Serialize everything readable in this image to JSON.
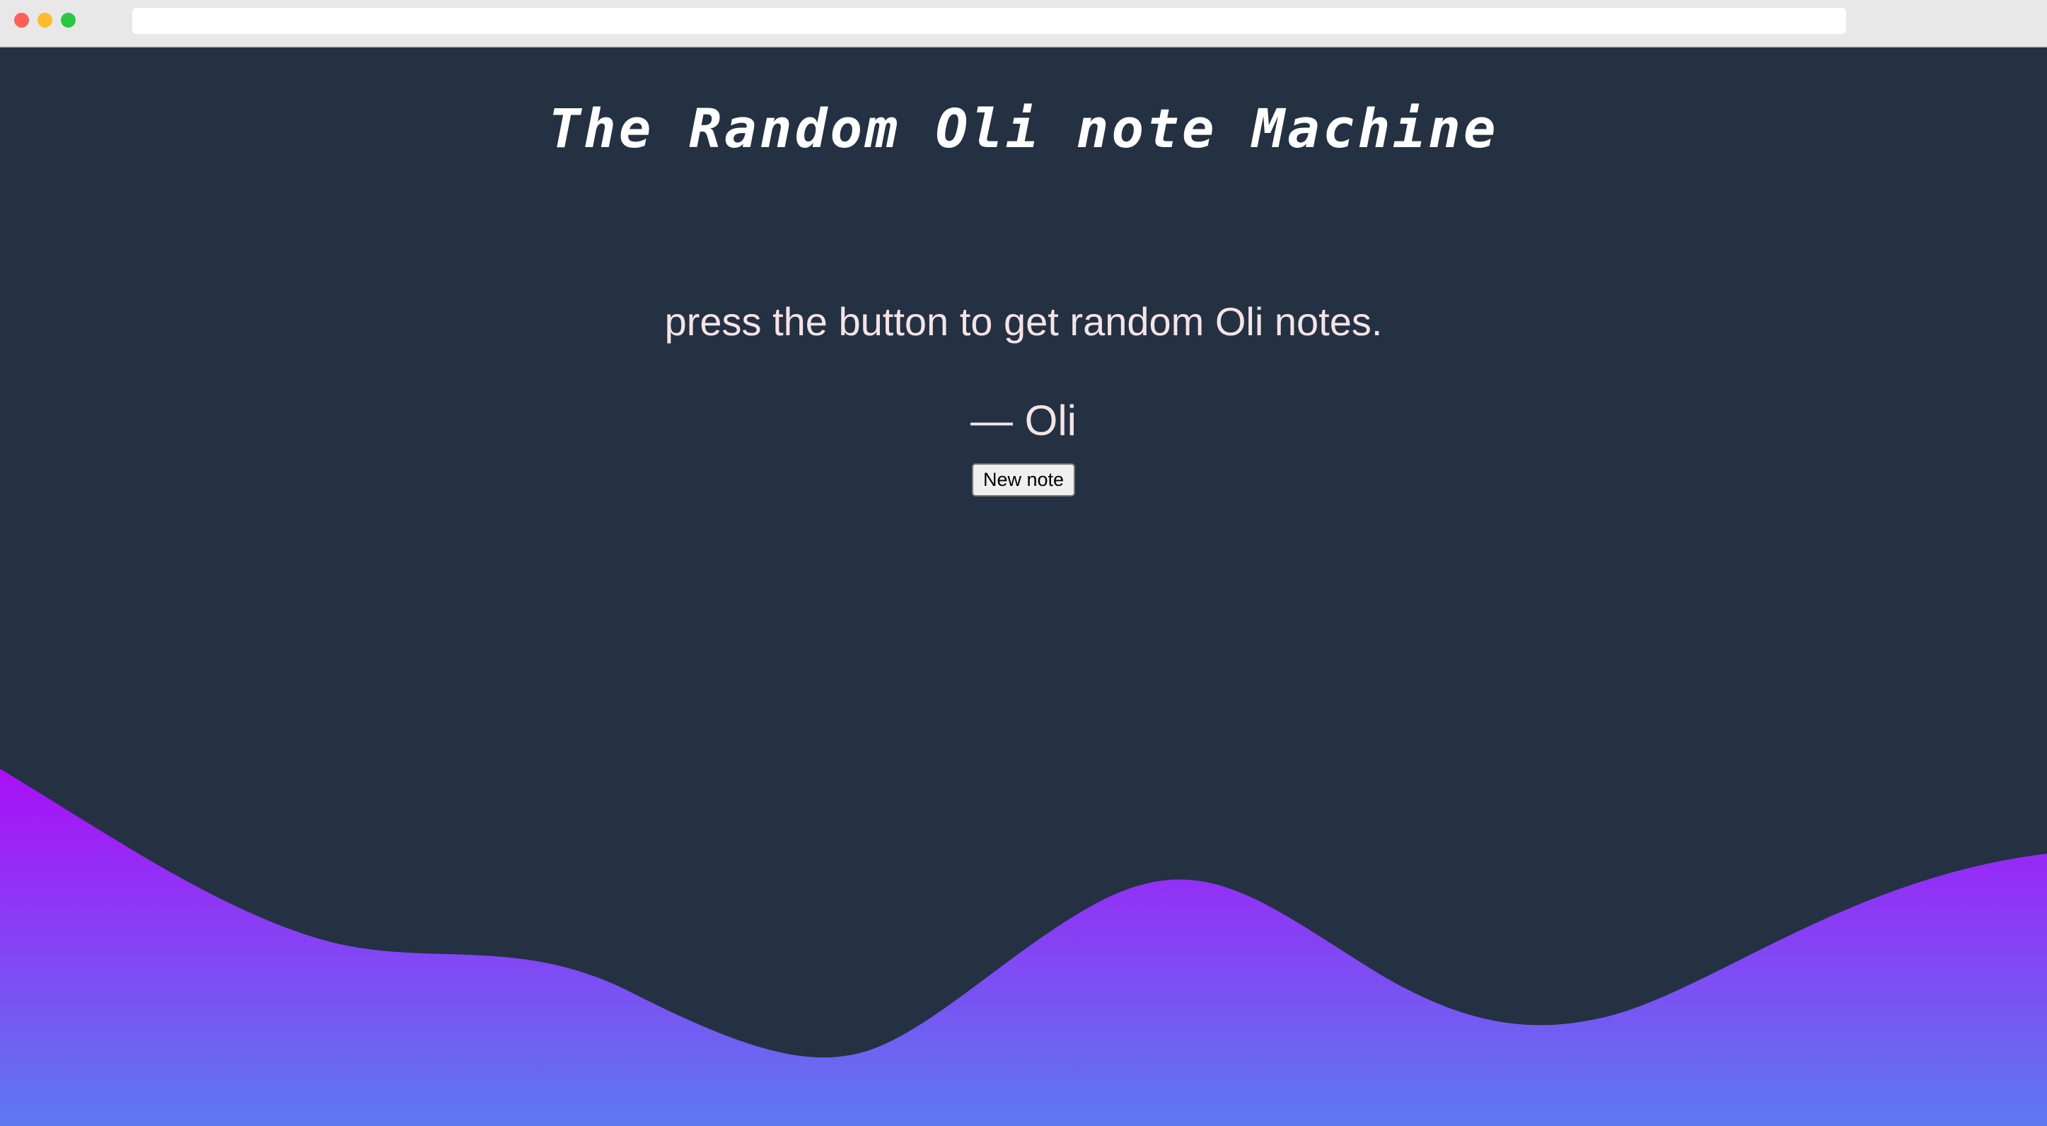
{
  "browser": {
    "address": ""
  },
  "app": {
    "title": "The Random Oli note Machine",
    "quote": "press the button to get random Oli notes.",
    "author": "— Oli",
    "button_label": "New note"
  },
  "colors": {
    "background": "#233142",
    "text": "#f4e4e6",
    "title": "#ffffff",
    "wave_top": "#aa0ff8",
    "wave_bottom": "#5e79f0"
  }
}
